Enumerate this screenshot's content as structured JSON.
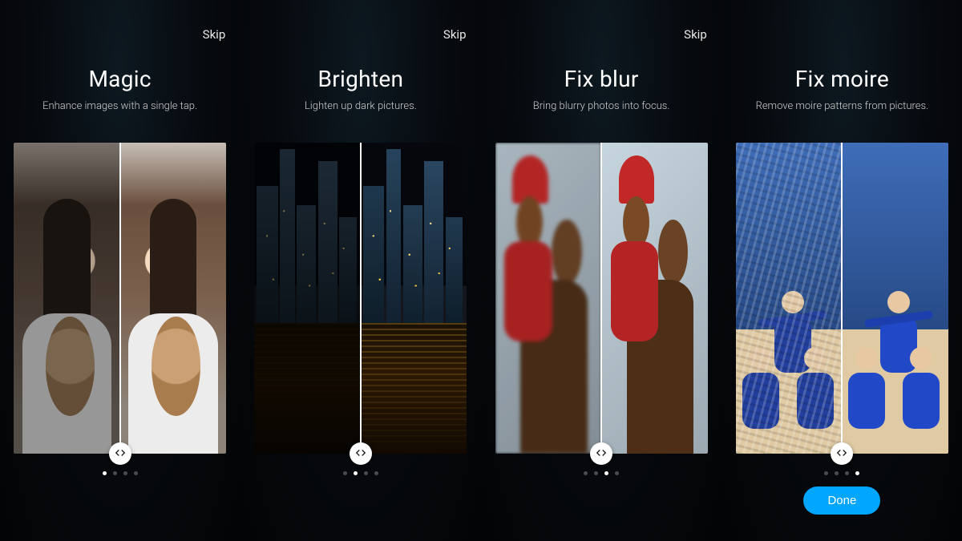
{
  "panels": [
    {
      "skip": "Skip",
      "title": "Magic",
      "subtitle": "Enhance images with a single tap.",
      "active_dot": 0,
      "image_left_desc": "smiling woman holding small dog, dimmer original",
      "image_right_desc": "smiling woman holding small dog, enhanced",
      "show_done": false
    },
    {
      "skip": "Skip",
      "title": "Brighten",
      "subtitle": "Lighten up dark pictures.",
      "active_dot": 1,
      "image_left_desc": "dark city skyline at night",
      "image_right_desc": "brightened city skyline with reflections",
      "show_done": false
    },
    {
      "skip": "Skip",
      "title": "Fix blur",
      "subtitle": "Bring blurry photos into focus.",
      "active_dot": 2,
      "image_left_desc": "blurry father carrying child in red cap",
      "image_right_desc": "sharp father carrying child in red cap",
      "show_done": false
    },
    {
      "skip": "",
      "title": "Fix moire",
      "subtitle": "Remove moire patterns from pictures.",
      "active_dot": 3,
      "image_left_desc": "soccer players celebrating with moire stripes",
      "image_right_desc": "soccer players celebrating, clean",
      "show_done": true
    }
  ],
  "dot_count": 4,
  "done_label": "Done",
  "handle_icon": "compare-arrows-icon",
  "colors": {
    "accent": "#00a6ff",
    "bg": "#06090d",
    "text": "#ffffff"
  }
}
